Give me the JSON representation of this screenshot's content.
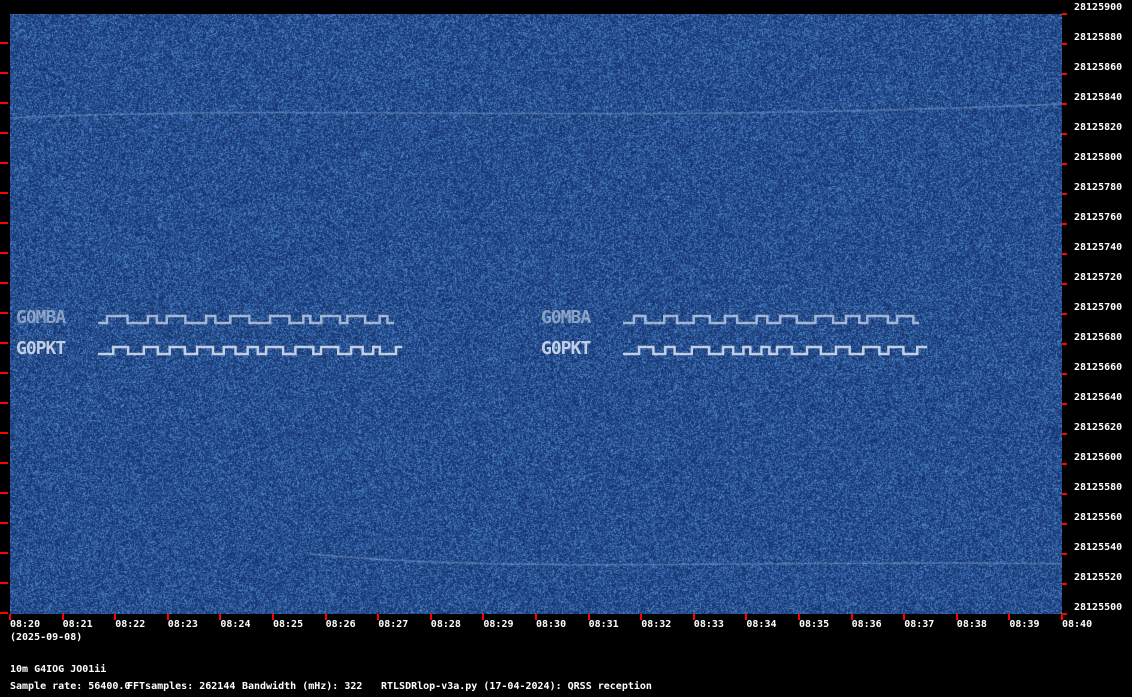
{
  "waterfall": {
    "freq_labels": [
      "28125900",
      "28125880",
      "28125860",
      "28125840",
      "28125820",
      "28125800",
      "28125780",
      "28125760",
      "28125740",
      "28125720",
      "28125700",
      "28125680",
      "28125660",
      "28125640",
      "28125620",
      "28125600",
      "28125580",
      "28125560",
      "28125540",
      "28125520",
      "28125500"
    ],
    "time_labels": [
      "08:20",
      "08:21",
      "08:22",
      "08:23",
      "08:24",
      "08:25",
      "08:26",
      "08:27",
      "08:28",
      "08:29",
      "08:30",
      "08:31",
      "08:32",
      "08:33",
      "08:34",
      "08:35",
      "08:36",
      "08:37",
      "08:38",
      "08:39",
      "08:40"
    ],
    "date": "(2025-09-08)",
    "signals": [
      {
        "label": "G0MBA",
        "trace": "_--,_-,-,-,-,-,-,_-,-,_-,-,-,_-",
        "intensity": "faint"
      },
      {
        "label": "G0PKT",
        "trace": "_-_-_-_-_-_-_-_-_-_-_-_-_-_-_-_-_",
        "intensity": "strong"
      }
    ],
    "colors": {
      "background": "#1b3f80",
      "signal": "#dde6f2",
      "tick": "#ff0000"
    }
  },
  "footer": {
    "station": "10m G4IOG JO01ii",
    "sample_rate": "Sample rate: 56400.0",
    "fft_samples": "FFTsamples: 262144",
    "bandwidth": "Bandwidth (mHz): 322",
    "software": "RTLSDRlop-v3a.py (17-04-2024): QRSS reception"
  }
}
